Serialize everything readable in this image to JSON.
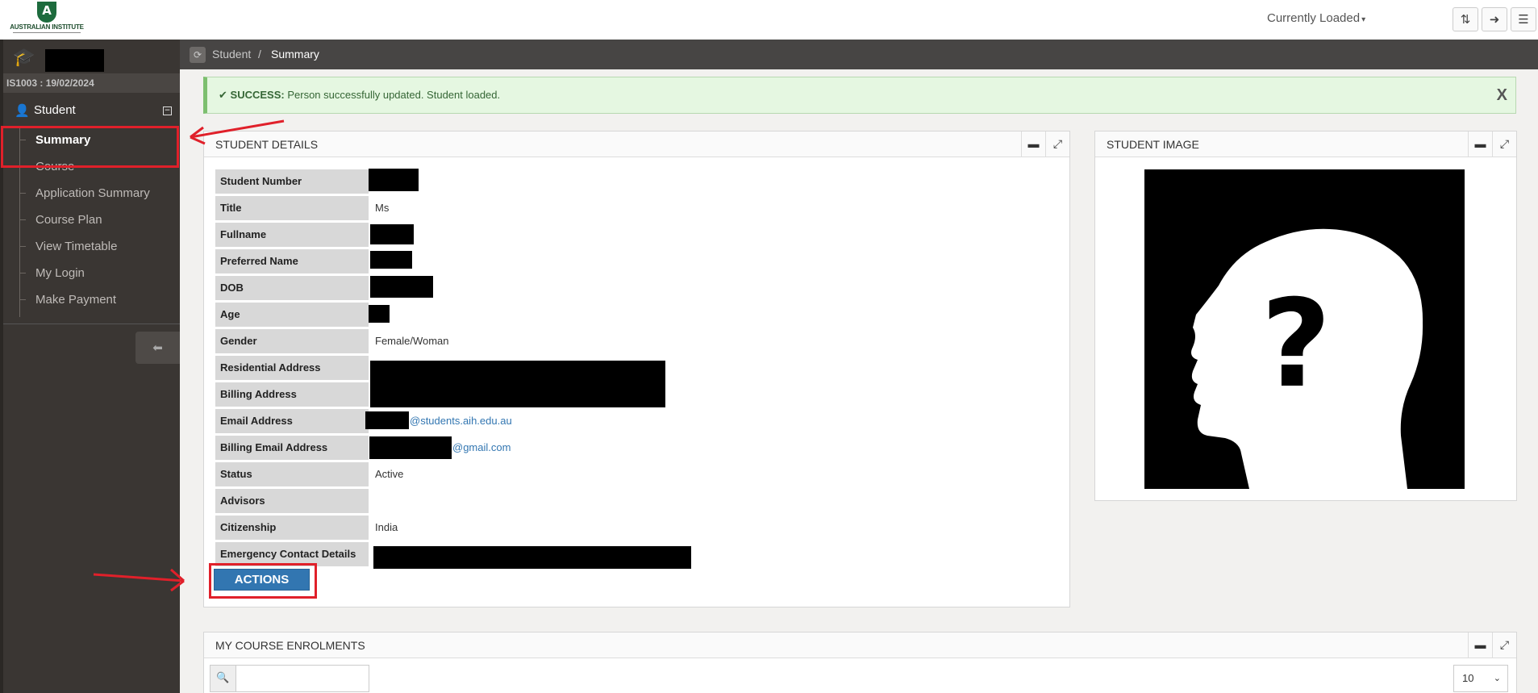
{
  "header": {
    "logo_letter": "A",
    "logo_text": "AUSTRALIAN INSTITUTE",
    "currently_loaded": "Currently Loaded",
    "buttons": [
      "sort-icon",
      "logout-icon",
      "menu-toggle-icon"
    ]
  },
  "sidebar": {
    "user_id": "IS1003 : 19/02/2024",
    "section_label": "Student",
    "items": [
      {
        "label": "Summary",
        "active": true
      },
      {
        "label": "Course"
      },
      {
        "label": "Application Summary"
      },
      {
        "label": "Course Plan"
      },
      {
        "label": "View Timetable"
      },
      {
        "label": "My Login"
      },
      {
        "label": "Make Payment"
      }
    ]
  },
  "breadcrumb": [
    "Student",
    "/",
    "Summary"
  ],
  "alert": {
    "check": "✔",
    "title": "SUCCESS:",
    "message": "Person successfully updated. Student loaded.",
    "close": "X"
  },
  "student_details": {
    "heading": "STUDENT DETAILS",
    "rows": [
      {
        "label": "Student Number",
        "value": ""
      },
      {
        "label": "Title",
        "value": "Ms"
      },
      {
        "label": "Fullname",
        "value": ""
      },
      {
        "label": "Preferred Name",
        "value": ""
      },
      {
        "label": "DOB",
        "value": ""
      },
      {
        "label": "Age",
        "value": ""
      },
      {
        "label": "Gender",
        "value": "Female/Woman"
      },
      {
        "label": "Residential Address",
        "value": ""
      },
      {
        "label": "Billing Address",
        "value": ""
      },
      {
        "label": "Email Address",
        "value": "@students.aih.edu.au"
      },
      {
        "label": "Billing Email Address",
        "value": "@gmail.com"
      },
      {
        "label": "Status",
        "value": "Active"
      },
      {
        "label": "Advisors",
        "value": ""
      },
      {
        "label": "Citizenship",
        "value": "India"
      },
      {
        "label": "Emergency Contact Details",
        "value": ""
      }
    ],
    "actions_label": "ACTIONS"
  },
  "student_image": {
    "heading": "STUDENT IMAGE",
    "placeholder_glyph": "?"
  },
  "enrolments": {
    "heading": "MY COURSE ENROLMENTS",
    "search_placeholder": "",
    "page_size": "10"
  },
  "colors": {
    "sidebar_bg": "#3a3633",
    "ribbon_bg": "#474544",
    "primary": "#3276b1",
    "success_bg": "#e5f7e1",
    "annotation_red": "#e0202a"
  }
}
